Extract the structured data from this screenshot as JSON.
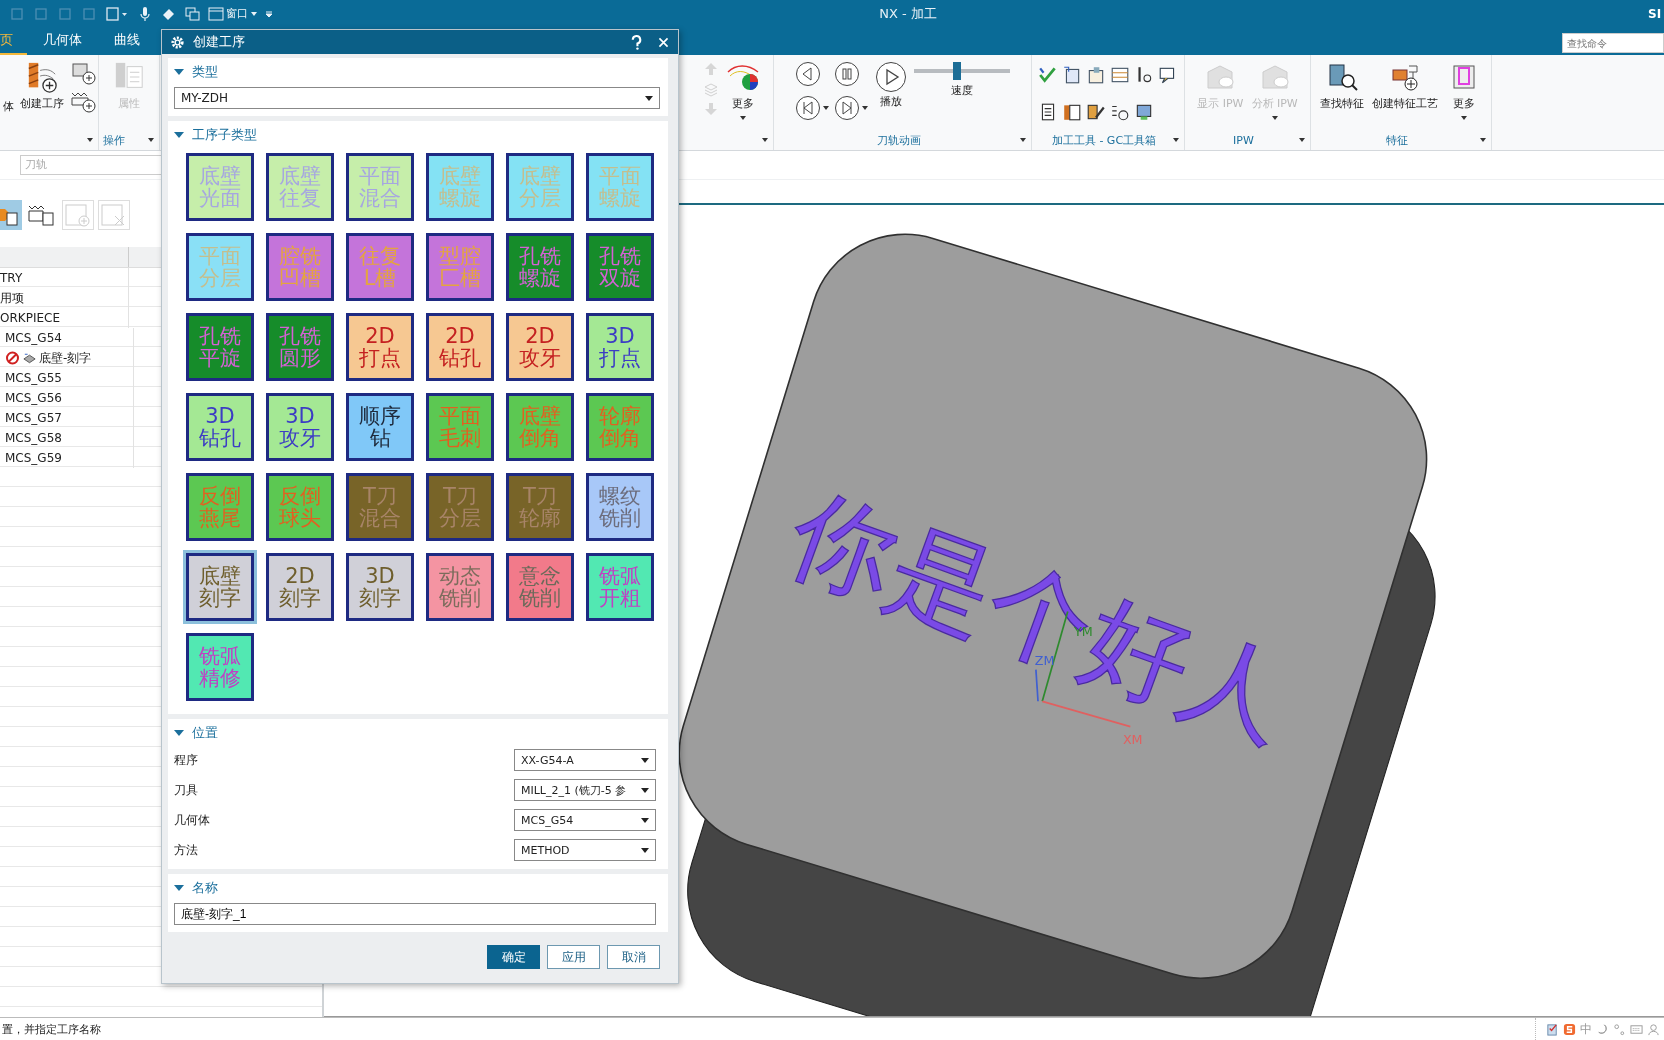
{
  "title_bar": {
    "quick_access_menu": "窗口",
    "title": "NX - 加工",
    "brand": "SI",
    "search": {
      "placeholder": "查找命令"
    }
  },
  "tabs": [
    {
      "label": "页",
      "selected": true
    },
    {
      "label": "几何体",
      "selected": false
    },
    {
      "label": "曲线",
      "selected": false
    }
  ],
  "ribbon": {
    "create_group": {
      "partial_label": "体",
      "create_operation": "创建工序"
    },
    "operation_group": {
      "title": "操作",
      "properties": {
        "label": "属性",
        "disabled": true
      }
    },
    "display_group": {
      "more": "更多"
    },
    "animation_group": {
      "title": "刀轨动画",
      "play": "播放",
      "speed": {
        "label": "速度",
        "level": 0.45
      }
    },
    "tools_group": {
      "title": "加工工具 - GC工具箱"
    },
    "ipw_group": {
      "title": "IPW",
      "buttons": [
        {
          "label": "显示 IPW",
          "disabled": true
        },
        {
          "label": "分析 IPW",
          "disabled": true
        }
      ]
    },
    "feature_group": {
      "title": "特征",
      "buttons": [
        {
          "label": "查找特征",
          "disabled": false
        },
        {
          "label": "创建特征工艺",
          "disabled": false
        },
        {
          "label": "更多",
          "disabled": false
        }
      ]
    }
  },
  "filter": {
    "value": "刀轨",
    "disabled": true
  },
  "navigator": {
    "tools": [
      {
        "kind": "program",
        "selected": true,
        "disabled": false
      },
      {
        "kind": "geometry",
        "selected": false,
        "disabled": false
      },
      {
        "kind": "add",
        "selected": false,
        "disabled": true
      },
      {
        "kind": "remove",
        "selected": false,
        "disabled": true
      }
    ],
    "rows": [
      {
        "label": "TRY",
        "kind": "group"
      },
      {
        "label": "用项",
        "kind": "group"
      },
      {
        "label": "ORKPIECE",
        "kind": "group",
        "children": [
          {
            "label": "MCS_G54",
            "kind": "group",
            "children": [
              {
                "label": "底壁-刻字",
                "kind": "operation"
              }
            ]
          },
          {
            "label": "MCS_G55",
            "kind": "group"
          },
          {
            "label": "MCS_G56",
            "kind": "group"
          },
          {
            "label": "MCS_G57",
            "kind": "group"
          },
          {
            "label": "MCS_G58",
            "kind": "group"
          },
          {
            "label": "MCS_G59",
            "kind": "group"
          }
        ]
      }
    ]
  },
  "dialog": {
    "title": "创建工序",
    "type_section": {
      "title": "类型",
      "expanded": true,
      "value": "MY-ZDH"
    },
    "subtype_section": {
      "title": "工序子类型",
      "expanded": true,
      "tiles": [
        {
          "label": "底壁光面",
          "color": "#c6eeaa",
          "selected": false
        },
        {
          "label": "底壁往复",
          "color": "#c6eeaa",
          "selected": false
        },
        {
          "label": "平面混合",
          "color": "#c6eeaa",
          "selected": false
        },
        {
          "label": "底壁螺旋",
          "color": "#84e2f4",
          "selected": false
        },
        {
          "label": "底壁分层",
          "color": "#84e2f4",
          "selected": false
        },
        {
          "label": "平面螺旋",
          "color": "#84e2f4",
          "selected": false
        },
        {
          "label": "平面分层",
          "color": "#8ae0f6",
          "selected": false
        },
        {
          "label": "腔铣凹槽",
          "color": "#c474da",
          "selected": false
        },
        {
          "label": "往复L槽",
          "color": "#c474da",
          "selected": false
        },
        {
          "label": "型腔匚槽",
          "color": "#c474da",
          "selected": false
        },
        {
          "label": "孔铣螺旋",
          "color": "#168c2a",
          "selected": false
        },
        {
          "label": "孔铣双旋",
          "color": "#168c2a",
          "selected": false
        },
        {
          "label": "孔铣平旋",
          "color": "#168c2a",
          "selected": false
        },
        {
          "label": "孔铣圆形",
          "color": "#168c2a",
          "selected": false
        },
        {
          "label": "2D打点",
          "color": "#f6c892",
          "selected": false
        },
        {
          "label": "2D钻孔",
          "color": "#f6c892",
          "selected": false
        },
        {
          "label": "2D攻牙",
          "color": "#f6c892",
          "selected": false
        },
        {
          "label": "3D打点",
          "color": "#a4e894",
          "selected": false
        },
        {
          "label": "3D钻孔",
          "color": "#a4e894",
          "selected": false
        },
        {
          "label": "3D攻牙",
          "color": "#a4e894",
          "selected": false
        },
        {
          "label": "顺序钻",
          "color": "#80c8f8",
          "selected": false
        },
        {
          "label": "平面毛刺",
          "color": "#5cc852",
          "selected": false
        },
        {
          "label": "底壁倒角",
          "color": "#5cc852",
          "selected": false
        },
        {
          "label": "轮廓倒角",
          "color": "#5cc852",
          "selected": false
        },
        {
          "label": "反倒燕尾",
          "color": "#5cc852",
          "selected": false
        },
        {
          "label": "反倒球头",
          "color": "#5cc852",
          "selected": false
        },
        {
          "label": "T刀混合",
          "color": "#786428",
          "selected": false
        },
        {
          "label": "T刀分层",
          "color": "#786428",
          "selected": false
        },
        {
          "label": "T刀轮廓",
          "color": "#786428",
          "selected": false
        },
        {
          "label": "螺纹铣削",
          "color": "#a8c8f8",
          "selected": false
        },
        {
          "label": "底壁刻字",
          "color": "#d0d0d8",
          "selected": true
        },
        {
          "label": "2D刻字",
          "color": "#d0d0d8",
          "selected": false
        },
        {
          "label": "3D刻字",
          "color": "#d0d0d8",
          "selected": false
        },
        {
          "label": "动态铣削",
          "color": "#f494a2",
          "selected": false
        },
        {
          "label": "意念铣削",
          "color": "#f27a8a",
          "selected": false
        },
        {
          "label": "铣弧开粗",
          "color": "#52e8b2",
          "selected": false
        },
        {
          "label": "铣弧精修",
          "color": "#52e8b2",
          "selected": false
        }
      ]
    },
    "location_section": {
      "title": "位置",
      "expanded": true,
      "fields": [
        {
          "label": "程序",
          "value": "XX-G54-A"
        },
        {
          "label": "刀具",
          "value": "MILL_2_1 (铣刀-5 参"
        },
        {
          "label": "几何体",
          "value": "MCS_G54"
        },
        {
          "label": "方法",
          "value": "METHOD"
        }
      ]
    },
    "name_section": {
      "title": "名称",
      "expanded": true,
      "value": "底壁-刻字_1"
    },
    "buttons": [
      {
        "label": "确定",
        "kind": "primary"
      },
      {
        "label": "应用",
        "kind": "secondary"
      },
      {
        "label": "取消",
        "kind": "secondary"
      }
    ]
  },
  "viewport": {
    "engraved_text": "你是个好人",
    "axes": [
      {
        "label": "YM",
        "color": "#2e8a2e"
      },
      {
        "label": "ZM",
        "color": "#4060d0"
      },
      {
        "label": "XM",
        "color": "#e06060"
      }
    ]
  },
  "status_bar": {
    "message": "置，并指定工序名称",
    "ime": "中"
  }
}
